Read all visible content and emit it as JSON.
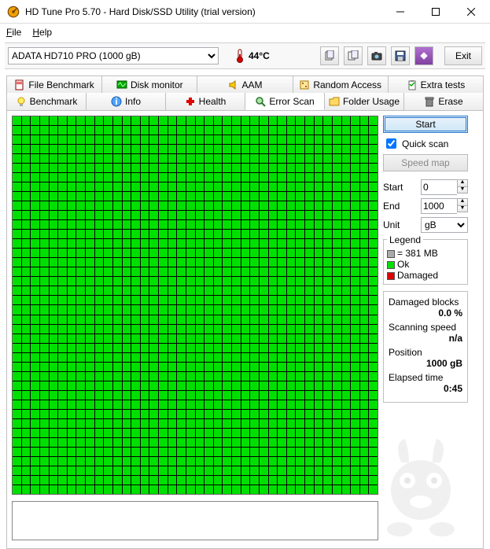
{
  "window": {
    "title": "HD Tune Pro 5.70 - Hard Disk/SSD Utility (trial version)"
  },
  "menu": {
    "file": "File",
    "help": "Help"
  },
  "toolbar": {
    "drive": "ADATA  HD710 PRO (1000 gB)",
    "temp": "44°C",
    "exit": "Exit"
  },
  "tabs": {
    "file_benchmark": "File Benchmark",
    "disk_monitor": "Disk monitor",
    "aam": "AAM",
    "random_access": "Random Access",
    "extra_tests": "Extra tests",
    "benchmark": "Benchmark",
    "info": "Info",
    "health": "Health",
    "error_scan": "Error Scan",
    "folder_usage": "Folder Usage",
    "erase": "Erase"
  },
  "side": {
    "start": "Start",
    "quick_scan": "Quick scan",
    "speed_map": "Speed map",
    "start_label": "Start",
    "start_val": "0",
    "end_label": "End",
    "end_val": "1000",
    "unit_label": "Unit",
    "unit_val": "gB"
  },
  "legend": {
    "title": "Legend",
    "block": "= 381 MB",
    "ok": "Ok",
    "damaged": "Damaged"
  },
  "stats": {
    "damaged_label": "Damaged blocks",
    "damaged_val": "0.0 %",
    "speed_label": "Scanning speed",
    "speed_val": "n/a",
    "position_label": "Position",
    "position_val": "1000 gB",
    "elapsed_label": "Elapsed time",
    "elapsed_val": "0:45"
  }
}
